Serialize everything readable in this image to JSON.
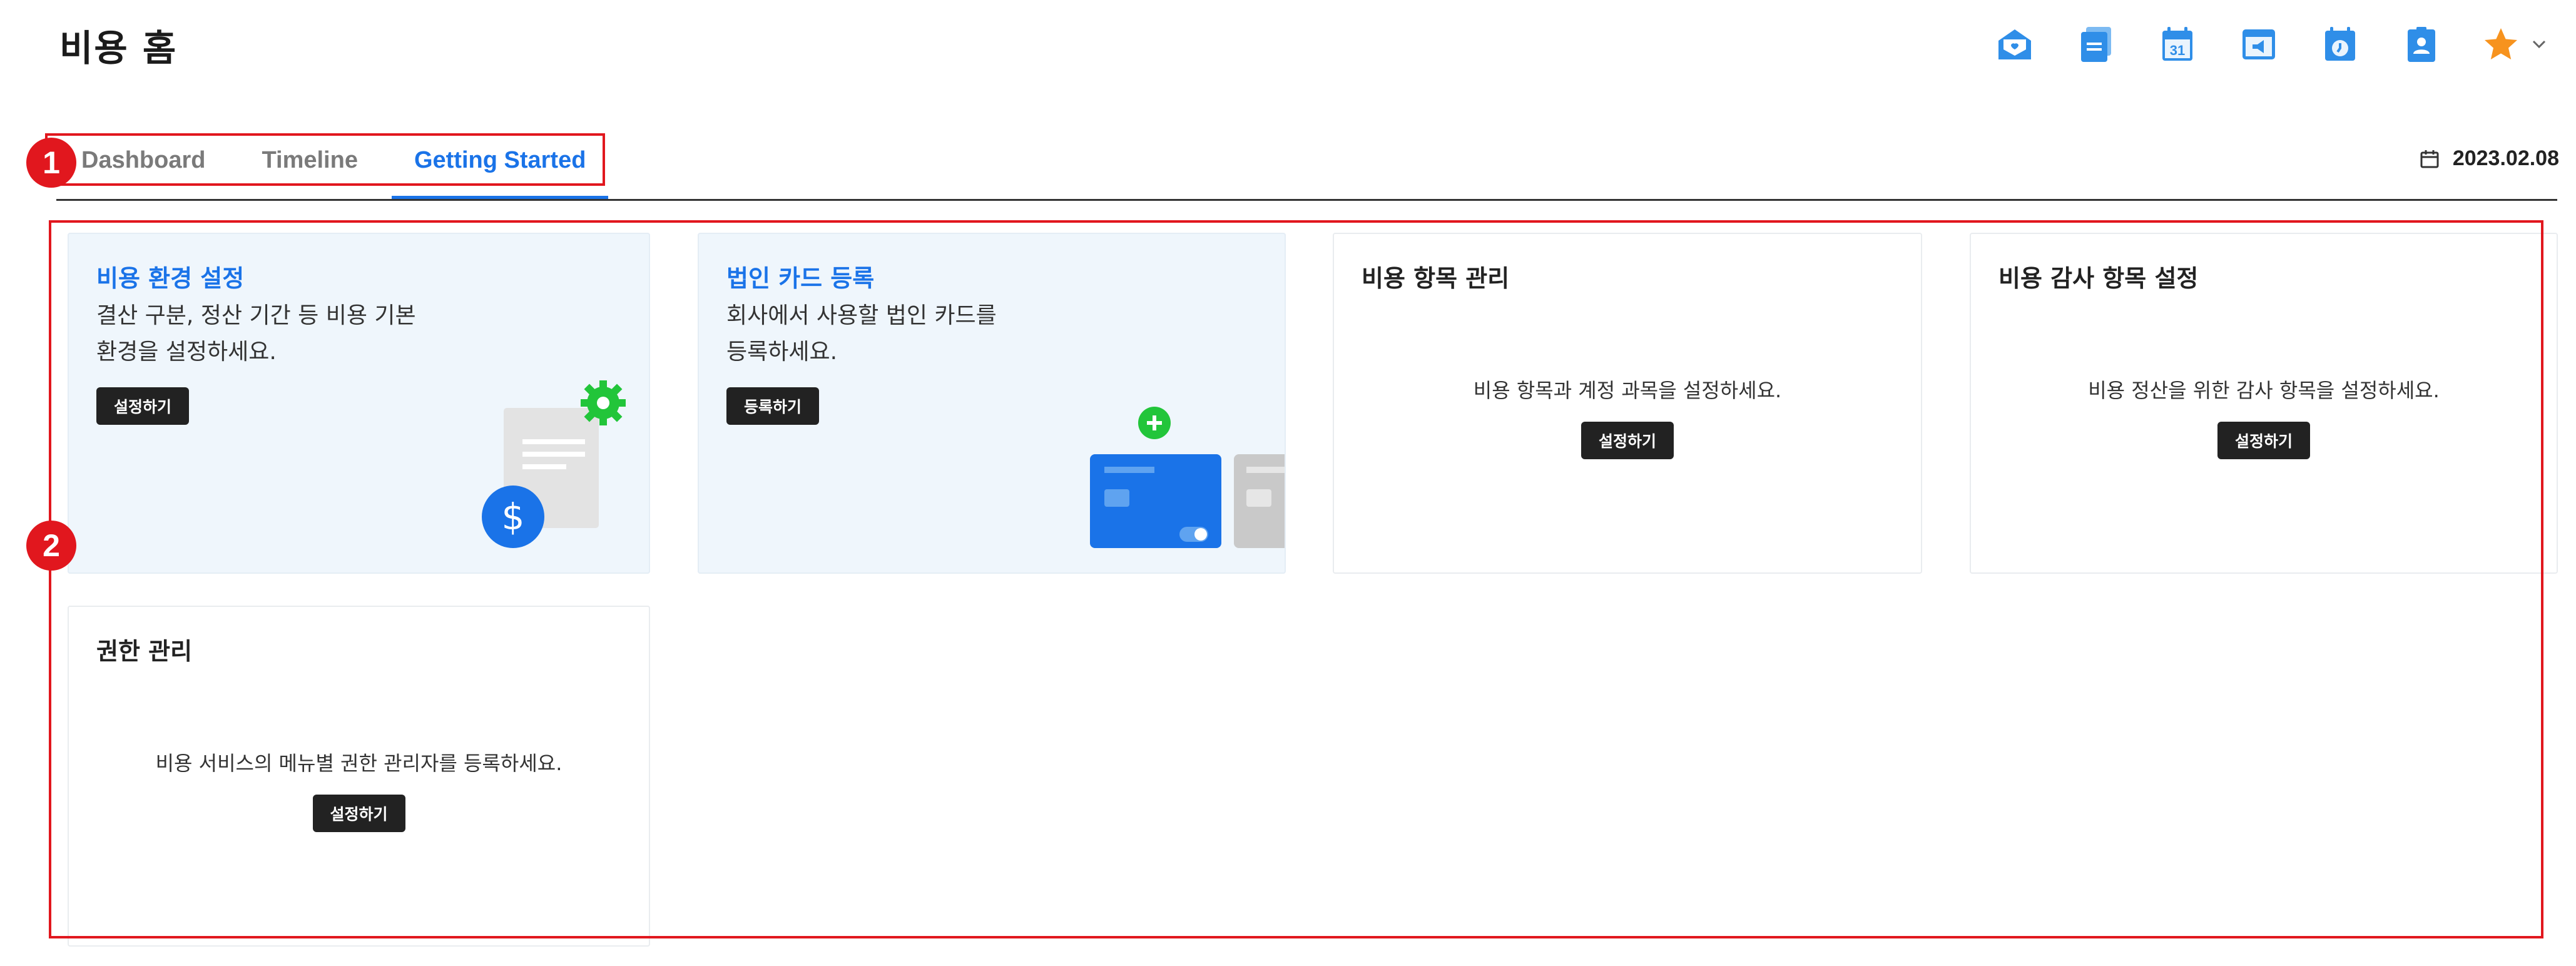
{
  "header": {
    "title": "비용 홈",
    "icons": [
      "mail-icon",
      "documents-icon",
      "calendar-31-icon",
      "announcement-icon",
      "schedule-icon",
      "contacts-icon"
    ],
    "favorite_icon": "star-icon"
  },
  "tabs": [
    {
      "label": "Dashboard",
      "active": false
    },
    {
      "label": "Timeline",
      "active": false
    },
    {
      "label": "Getting Started",
      "active": true
    }
  ],
  "date": "2023.02.08",
  "callouts": {
    "one": "1",
    "two": "2"
  },
  "cards": [
    {
      "title": "비용 환경 설정",
      "desc_line1": "결산 구분, 정산 기간 등 비용 기본",
      "desc_line2": "환경을 설정하세요.",
      "button": "설정하기"
    },
    {
      "title": "법인 카드 등록",
      "desc_line1": "회사에서 사용할 법인 카드를",
      "desc_line2": "등록하세요.",
      "button": "등록하기"
    },
    {
      "title": "비용 항목 관리",
      "desc": "비용 항목과 계정 과목을 설정하세요.",
      "button": "설정하기"
    },
    {
      "title": "비용 감사 항목 설정",
      "desc": "비용 정산을 위한 감사 항목을 설정하세요.",
      "button": "설정하기"
    },
    {
      "title": "권한 관리",
      "desc": "비용 서비스의 메뉴별 권한 관리자를 등록하세요.",
      "button": "설정하기"
    }
  ],
  "colors": {
    "accent": "#1a73e8",
    "callout": "#e1171e",
    "card_blue": "#eff6fc",
    "icon_blue": "#2f8ee8",
    "star": "#f7931e",
    "green": "#22c53a"
  }
}
